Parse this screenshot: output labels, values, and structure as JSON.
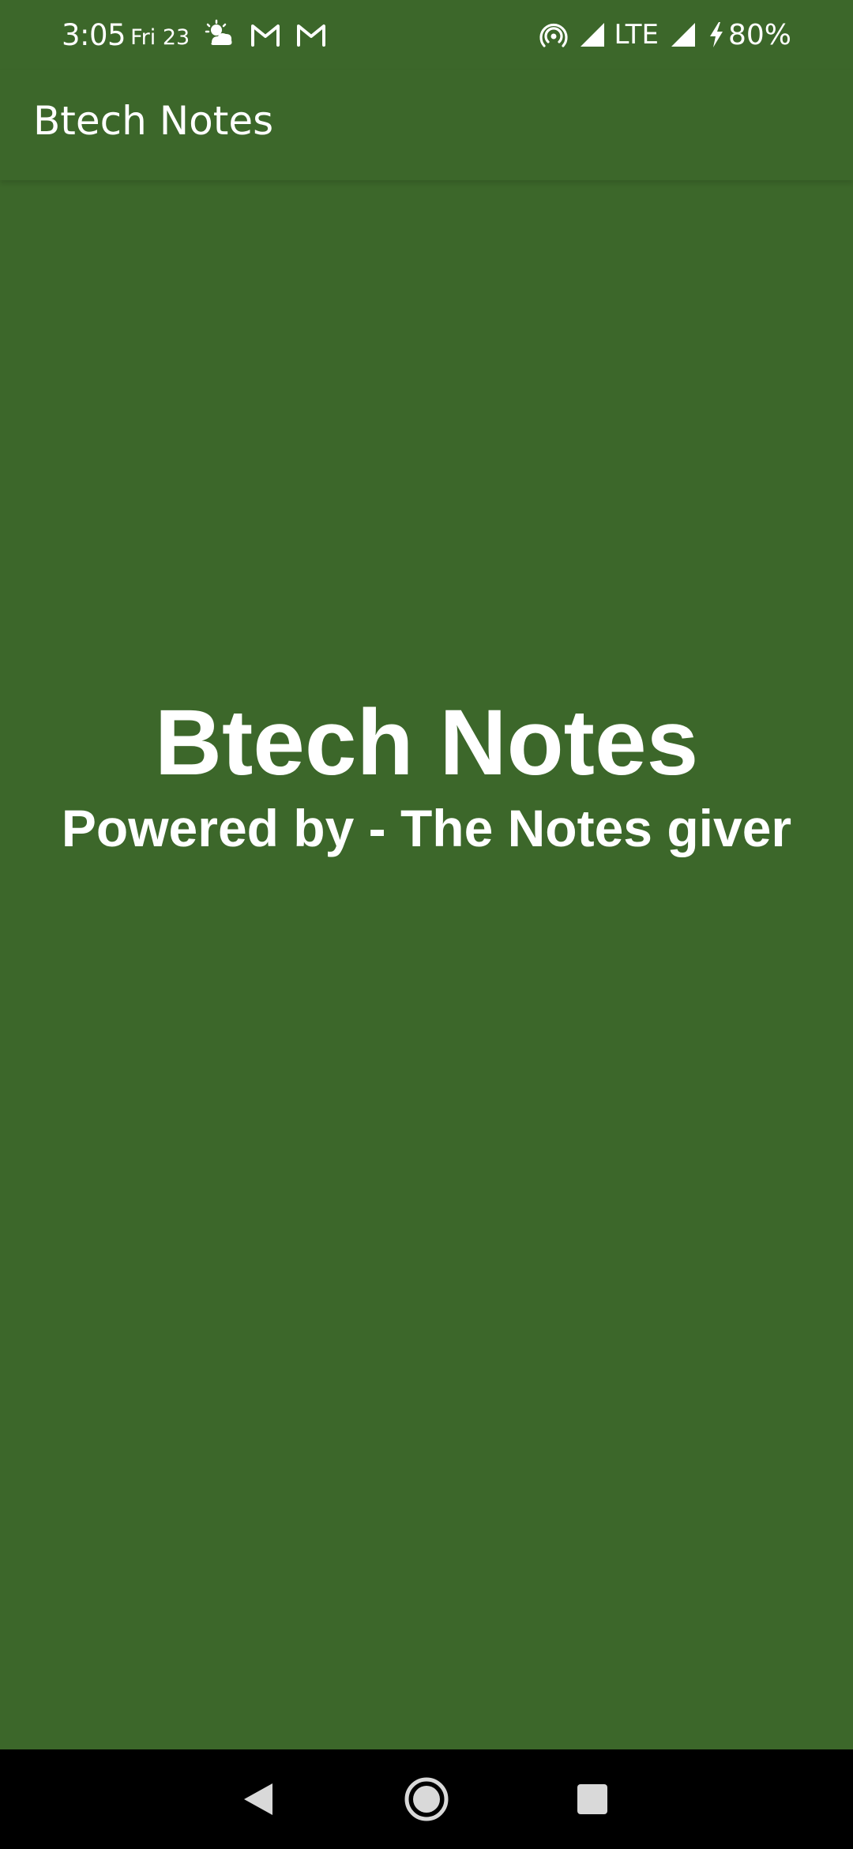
{
  "status_bar": {
    "time": "3:05",
    "date": "Fri 23",
    "network": "LTE",
    "battery": "80%",
    "icons_left": [
      "weather-icon",
      "gmail-icon",
      "gmail-icon"
    ],
    "icons_right": [
      "hotspot-icon",
      "signal-icon",
      "signal-icon",
      "charging-icon"
    ]
  },
  "app_bar": {
    "title": "Btech Notes"
  },
  "splash": {
    "title": "Btech Notes",
    "subtitle": "Powered by - The Notes giver"
  },
  "nav_bar": {
    "buttons": [
      "back-icon",
      "home-icon",
      "recents-icon"
    ]
  },
  "colors": {
    "background": "#3C672A",
    "text": "#FFFFFF",
    "nav_bar": "#000000"
  }
}
